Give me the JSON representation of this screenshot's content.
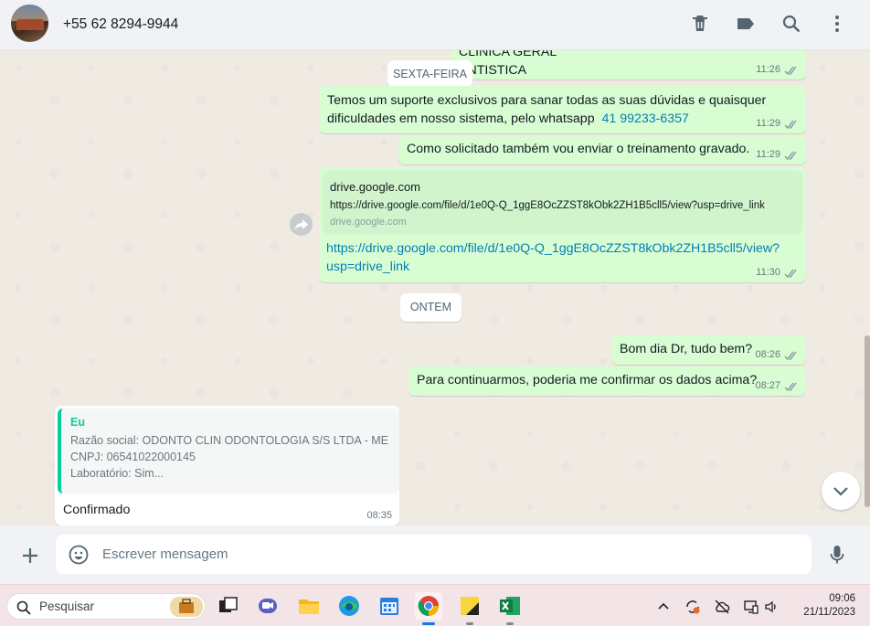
{
  "header": {
    "contact": "+55 62 8294-9944"
  },
  "messages": {
    "top_partial_1": "CLÍNICA GERAL",
    "top_partial_2": "ENTISTICA",
    "top_partial_time": "11:26",
    "day1": "SEXTA-FEIRA",
    "m1_line1": "Temos um suporte exclusivos para sanar todas as suas dúvidas e quaisquer",
    "m1_line2": "dificuldades em nosso sistema, pelo whatsapp",
    "m1_phone": "41 99233-6357",
    "m1_time": "11:29",
    "m2_text": "Como solicitado também vou enviar o treinamento gravado.",
    "m2_time": "11:29",
    "m3_preview_title": "drive.google.com",
    "m3_preview_url": "https://drive.google.com/file/d/1e0Q-Q_1ggE8OcZZST8kObk2ZH1B5cll5/view?usp=drive_link",
    "m3_preview_domain": "drive.google.com",
    "m3_link_line1": "https://drive.google.com/file/d/1e0Q-Q_1ggE8OcZZST8kObk2ZH1B5cll5/view?",
    "m3_link_line2": "usp=drive_link",
    "m3_time": "11:30",
    "day2": "ONTEM",
    "m4_text": "Bom dia Dr, tudo bem?",
    "m4_time": "08:26",
    "m5_text": "Para continuarmos, poderia me confirmar os dados acima?",
    "m5_time": "08:27",
    "m6_quote_author": "Eu",
    "m6_quote_line1": "Razão social: ODONTO CLIN ODONTOLOGIA S/S LTDA - ME",
    "m6_quote_line2": "CNPJ: 06541022000145",
    "m6_quote_line3": "Laboratório: Sim...",
    "m6_text": "Confirmado",
    "m6_time": "08:35"
  },
  "composer": {
    "placeholder": "Escrever mensagem"
  },
  "taskbar": {
    "search_label": "Pesquisar",
    "time": "09:06",
    "date": "21/11/2023"
  },
  "colors": {
    "outgoing_bubble": "#d9fdd3",
    "incoming_bubble": "#ffffff",
    "chat_background": "#efeae2",
    "link": "#027eb5",
    "quote_accent": "#06cf9c",
    "read_ticks": "#8696a0"
  }
}
